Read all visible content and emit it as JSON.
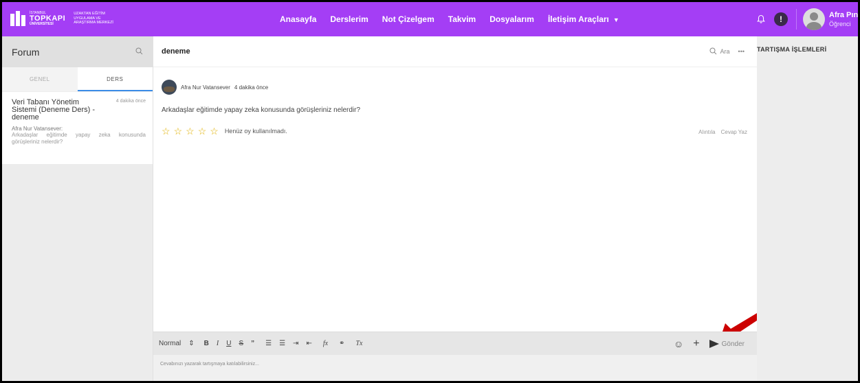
{
  "logo": {
    "line1": "İSTANBUL",
    "line2": "TOPKAPI",
    "line3": "ÜNİVERSİTESİ",
    "side1": "UZAKTAN EĞİTİM",
    "side2": "UYGULAMA VE",
    "side3": "ARAŞTIRMA MERKEZİ"
  },
  "nav": {
    "items": [
      "Anasayfa",
      "Derslerim",
      "Not Çizelgem",
      "Takvim",
      "Dosyalarım",
      "İletişim Araçları"
    ]
  },
  "user": {
    "name": "Afra Pınar",
    "role": "Öğrenci"
  },
  "forum": {
    "title": "Forum",
    "tabs": [
      "GENEL",
      "DERS"
    ],
    "thread": {
      "title": "Veri Tabanı Yönetim Sistemi (Deneme Ders) - deneme",
      "time": "4 dakika önce",
      "author": "Afra Nur Vatansever:",
      "excerpt": "Arkadaşlar eğitimde yapay zeka konusunda görüşleriniz nelerdir?"
    }
  },
  "topic": {
    "title": "deneme",
    "search_label": "Ara",
    "more_label": "•••"
  },
  "post": {
    "author": "Afra Nur Vatansever",
    "time": "4 dakika önce",
    "body": "Arkadaşlar eğitimde yapay zeka konusunda görüşleriniz nelerdir?",
    "rating": 0,
    "vote_text": "Henüz oy kullanılmadı.",
    "quote_label": "Alıntıla",
    "reply_label": "Cevap Yaz"
  },
  "editor": {
    "format": "Normal",
    "send_label": "Gönder",
    "placeholder": "Cevabınızı yazarak tartışmaya katılabilirsiniz..."
  },
  "right_panel": {
    "title": "TARTIŞMA İŞLEMLERİ"
  },
  "colors": {
    "topbar": "#a43ef5",
    "star": "#e0b000",
    "annotation_arrow": "#cc0000"
  }
}
